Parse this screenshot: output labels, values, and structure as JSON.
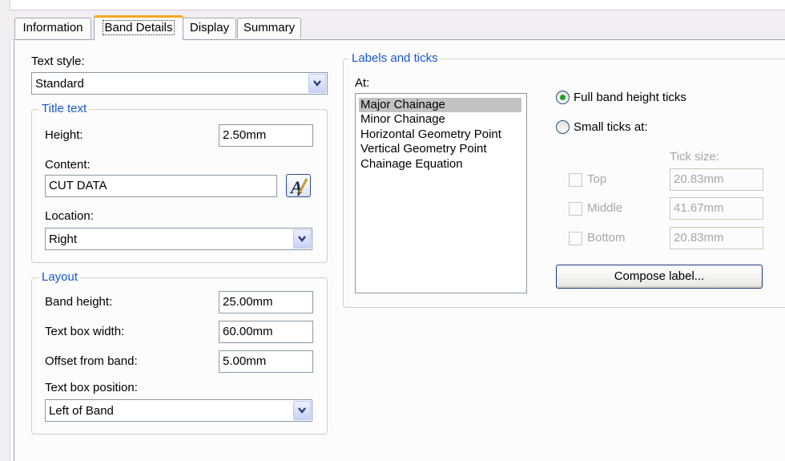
{
  "tabs": [
    {
      "label": "Information",
      "active": false
    },
    {
      "label": "Band Details",
      "active": true
    },
    {
      "label": "Display",
      "active": false
    },
    {
      "label": "Summary",
      "active": false
    }
  ],
  "text_style": {
    "label": "Text style:",
    "value": "Standard"
  },
  "title_text": {
    "legend": "Title text",
    "height_label": "Height:",
    "height_value": "2.50mm",
    "content_label": "Content:",
    "content_value": "CUT DATA",
    "location_label": "Location:",
    "location_value": "Right"
  },
  "layout": {
    "legend": "Layout",
    "band_height_label": "Band height:",
    "band_height_value": "25.00mm",
    "text_box_width_label": "Text box width:",
    "text_box_width_value": "60.00mm",
    "offset_label": "Offset from band:",
    "offset_value": "5.00mm",
    "position_label": "Text box position:",
    "position_value": "Left of Band"
  },
  "labels_ticks": {
    "legend": "Labels and ticks",
    "at_label": "At:",
    "items": [
      {
        "label": "Major Chainage",
        "selected": true
      },
      {
        "label": "Minor Chainage",
        "selected": false
      },
      {
        "label": "Horizontal Geometry Point",
        "selected": false
      },
      {
        "label": "Vertical Geometry Point",
        "selected": false
      },
      {
        "label": "Chainage Equation",
        "selected": false
      }
    ],
    "full_band_label": "Full band height ticks",
    "full_band_selected": true,
    "small_ticks_label": "Small ticks at:",
    "tick_size_label": "Tick size:",
    "top_label": "Top",
    "top_value": "20.83mm",
    "middle_label": "Middle",
    "middle_value": "41.67mm",
    "bottom_label": "Bottom",
    "bottom_value": "20.83mm",
    "compose_label": "Compose label..."
  },
  "colors": {
    "legend_blue": "#1a57c8",
    "active_tab_accent": "#f5a623",
    "radio_dot": "#1fa02a"
  }
}
